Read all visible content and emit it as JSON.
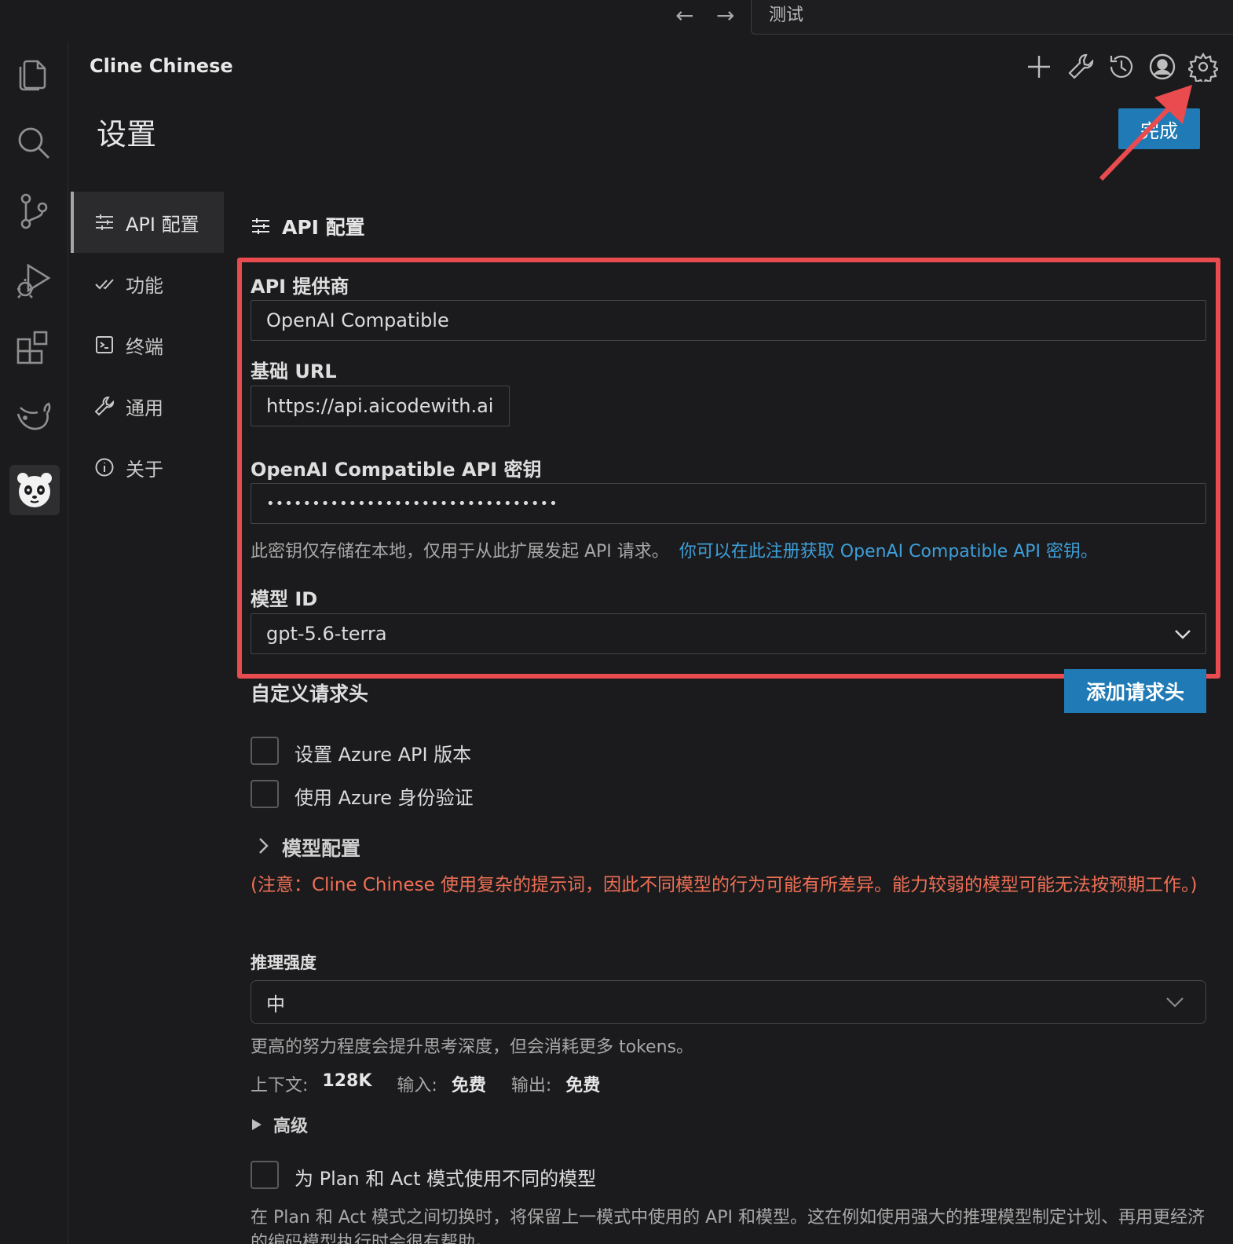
{
  "titlebar": {
    "back_arrow": "←",
    "forward_arrow": "→",
    "search_text": "测试"
  },
  "activity_bar": {
    "icons": [
      "explorer-icon",
      "search-icon",
      "source-control-icon",
      "run-debug-icon",
      "extensions-icon",
      "whale-icon",
      "panda-icon"
    ]
  },
  "header": {
    "view_title": "Cline Chinese",
    "toolbar_icons": [
      "plus-icon",
      "wrench-icon",
      "history-icon",
      "account-icon",
      "gear-icon"
    ]
  },
  "page": {
    "title": "设置",
    "done_label": "完成"
  },
  "nav": {
    "items": [
      {
        "label": "API 配置",
        "icon": "sliders-icon",
        "active": true
      },
      {
        "label": "功能",
        "icon": "check-icon"
      },
      {
        "label": "终端",
        "icon": "terminal-icon"
      },
      {
        "label": "通用",
        "icon": "wrench-icon"
      },
      {
        "label": "关于",
        "icon": "info-icon"
      }
    ]
  },
  "api": {
    "section_title": "API 配置",
    "provider_label": "API 提供商",
    "provider_value": "OpenAI Compatible",
    "base_url_label": "基础 URL",
    "base_url_value": "https://api.aicodewith.ai",
    "key_label": "OpenAI Compatible API 密钥",
    "key_value": "••••••••••••••••••••••••••••••••",
    "key_help": "此密钥仅存储在本地，仅用于从此扩展发起 API 请求。",
    "key_link": "你可以在此注册获取 OpenAI Compatible API 密钥。",
    "model_label": "模型 ID",
    "model_value": "gpt-5.6-terra"
  },
  "headers": {
    "title": "自定义请求头",
    "add_label": "添加请求头"
  },
  "options": {
    "azure_version": "设置 Azure API 版本",
    "azure_identity": "使用 Azure 身份验证"
  },
  "model_config": {
    "title": "模型配置",
    "warning": "(注意：Cline Chinese 使用复杂的提示词，因此不同模型的行为可能有所差异。能力较弱的模型可能无法按预期工作。)",
    "reasoning_label": "推理强度",
    "reasoning_value": "中",
    "reasoning_help": "更高的努力程度会提升思考深度，但会消耗更多 tokens。",
    "context_label": "上下文:",
    "context_value": "128K",
    "input_label": "输入:",
    "input_value": "免费",
    "output_label": "输出:",
    "output_value": "免费",
    "advanced_label": "高级"
  },
  "plan_act": {
    "label": "为 Plan 和 Act 模式使用不同的模型",
    "help": "在 Plan 和 Act 模式之间切换时，将保留上一模式中使用的 API 和模型。这在例如使用强大的推理模型制定计划、再用更经济的编码模型执行时会很有帮助。"
  },
  "colors": {
    "accent": "#1f7ab5",
    "highlight": "#ea4b4f",
    "warning": "#ef6f55",
    "link": "#3e9fd9"
  }
}
